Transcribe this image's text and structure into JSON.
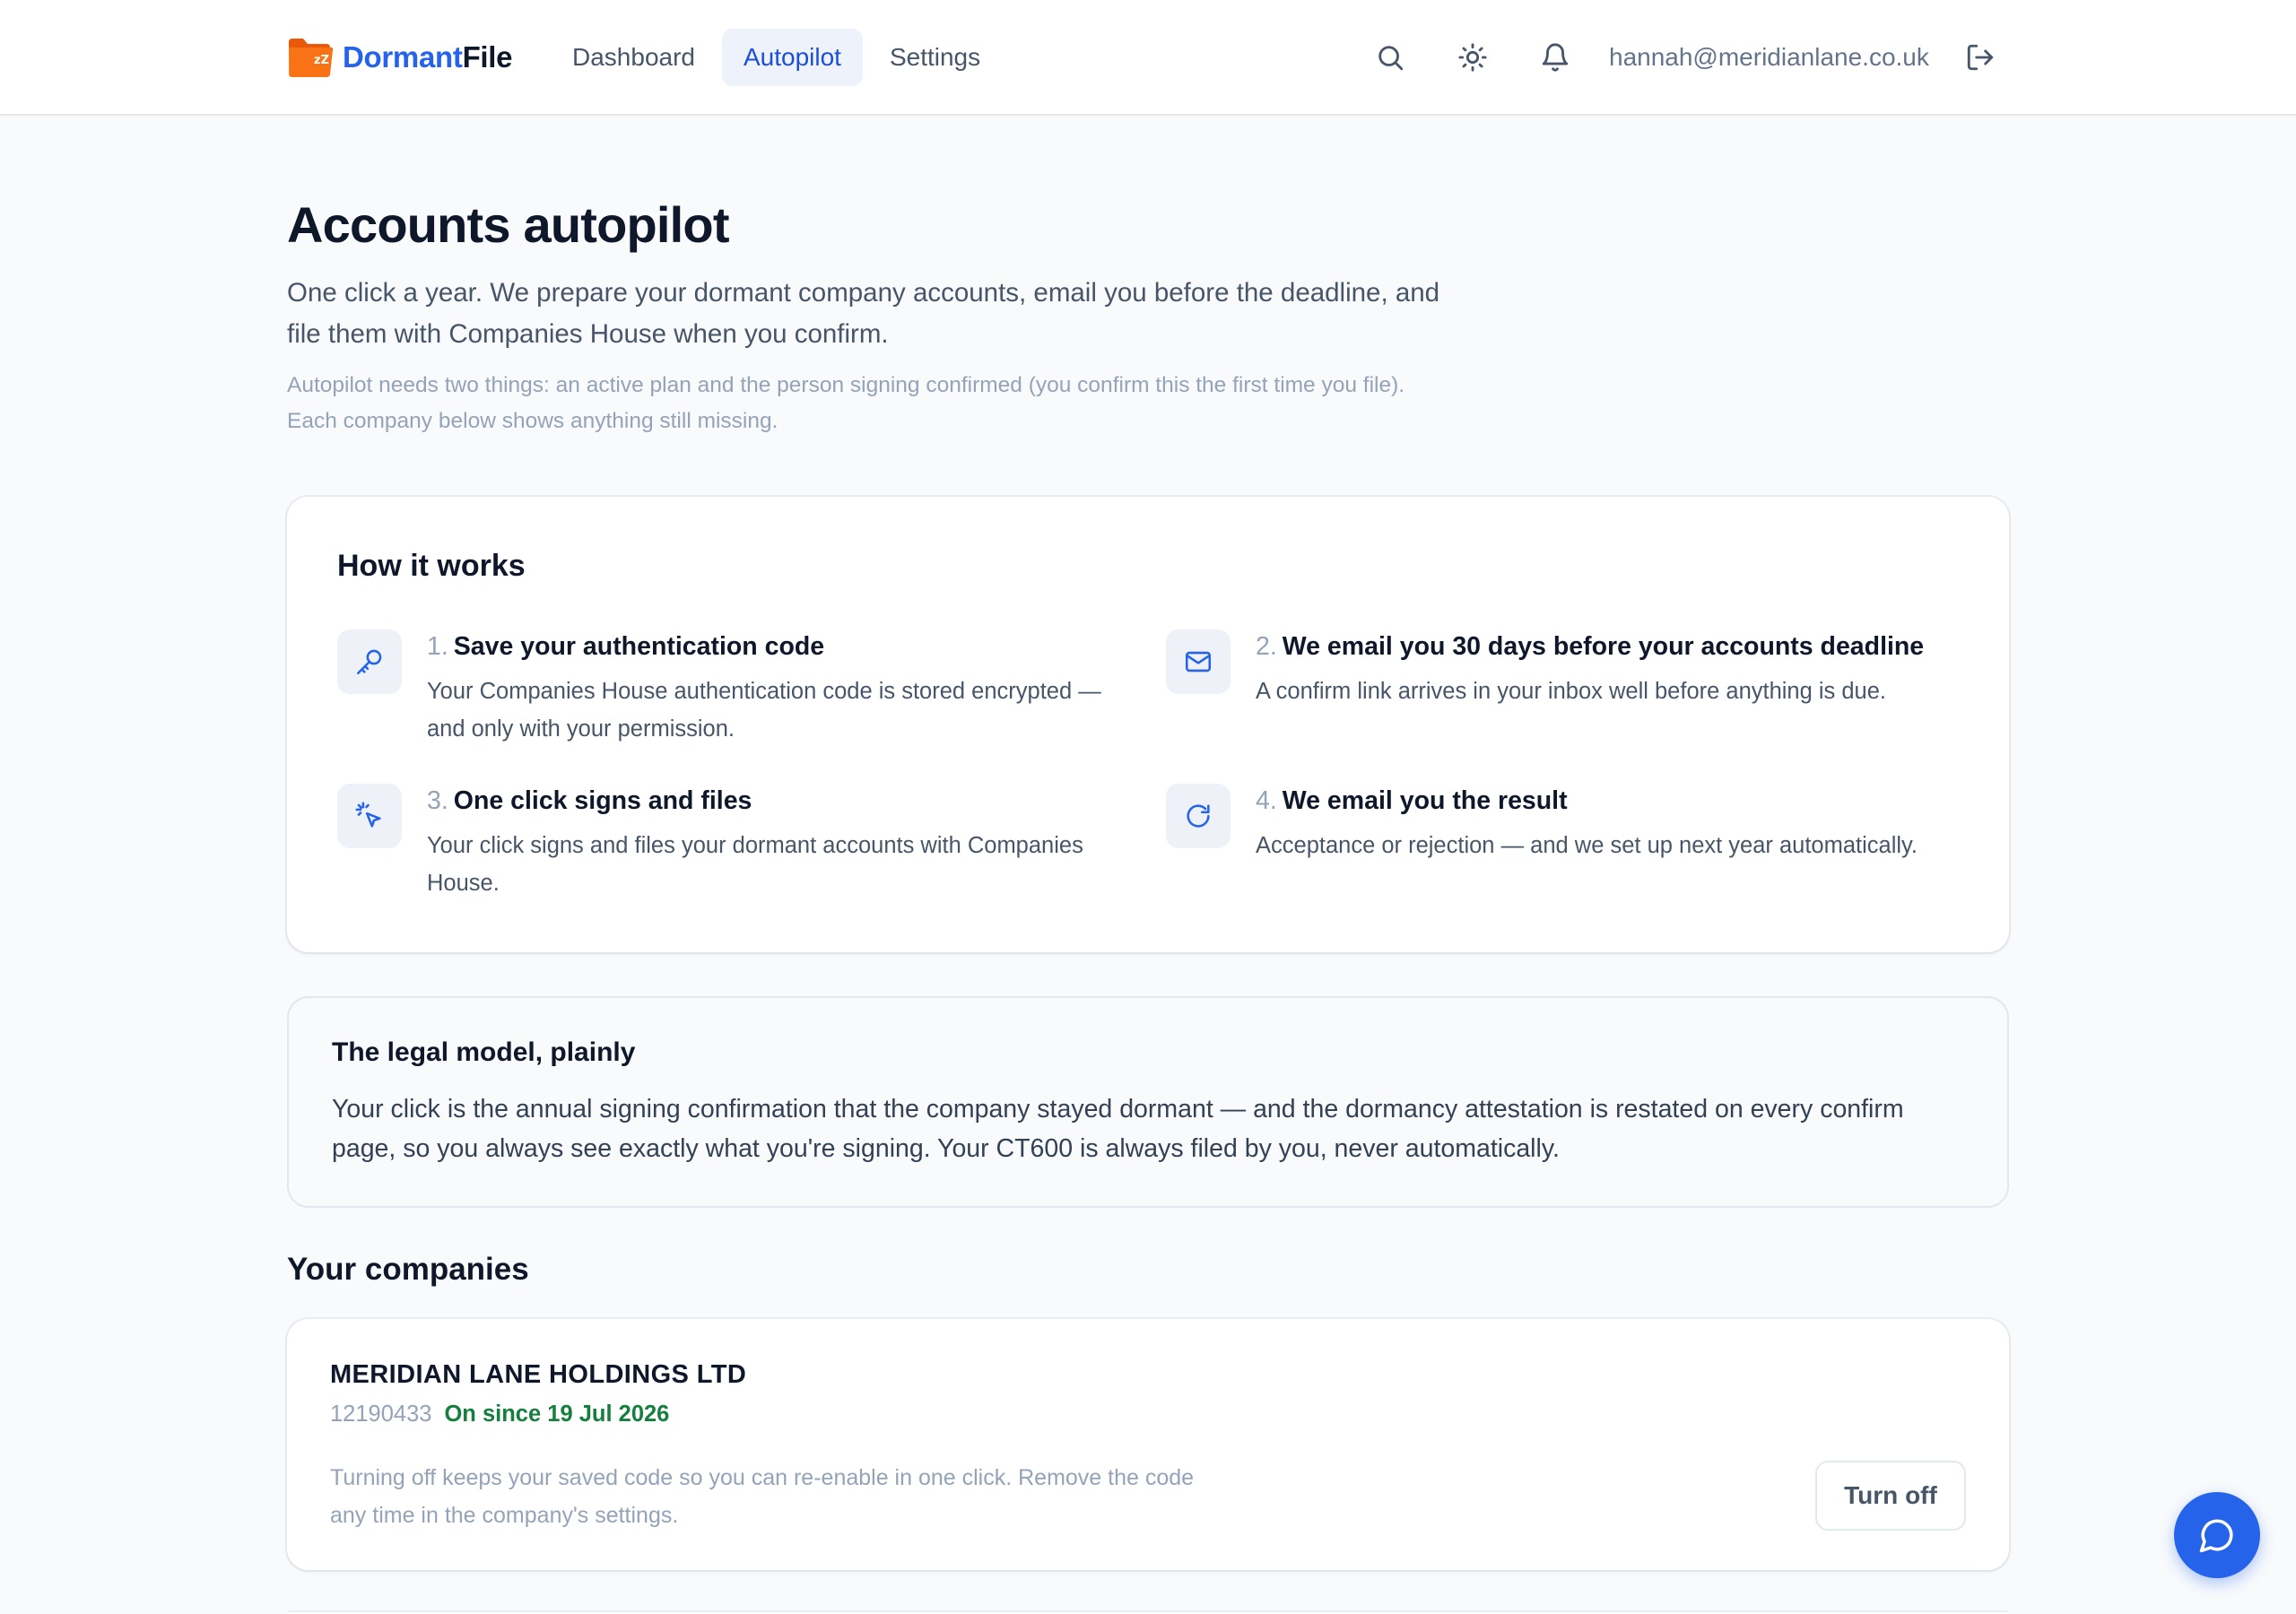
{
  "header": {
    "logo_part1": "Dormant",
    "logo_part2": "File",
    "nav": [
      {
        "label": "Dashboard",
        "active": false
      },
      {
        "label": "Autopilot",
        "active": true
      },
      {
        "label": "Settings",
        "active": false
      }
    ],
    "icons": [
      "search-icon",
      "theme-sun-icon",
      "bell-icon",
      "logout-icon"
    ],
    "user_email": "hannah@meridianlane.co.uk"
  },
  "page": {
    "title": "Accounts autopilot",
    "lead": "One click a year. We prepare your dormant company accounts, email you before the deadline, and file them with Companies House when you confirm.",
    "note": "Autopilot needs two things: an active plan and the person signing confirmed (you confirm this the first time you file). Each company below shows anything still missing."
  },
  "how_it_works": {
    "title": "How it works",
    "steps": [
      {
        "num": "1.",
        "title": "Save your authentication code",
        "desc": "Your Companies House authentication code is stored encrypted — and only with your permission.",
        "icon": "key-icon"
      },
      {
        "num": "2.",
        "title": "We email you 30 days before your accounts deadline",
        "desc": "A confirm link arrives in your inbox well before anything is due.",
        "icon": "mail-icon"
      },
      {
        "num": "3.",
        "title": "One click signs and files",
        "desc": "Your click signs and files your dormant accounts with Companies House.",
        "icon": "click-icon"
      },
      {
        "num": "4.",
        "title": "We email you the result",
        "desc": "Acceptance or rejection — and we set up next year automatically.",
        "icon": "refresh-icon"
      }
    ]
  },
  "legal": {
    "title": "The legal model, plainly",
    "body": "Your click is the annual signing confirmation that the company stayed dormant — and the dormancy attestation is restated on every confirm page, so you always see exactly what you're signing. Your CT600 is always filed by you, never automatically."
  },
  "companies": {
    "title": "Your companies",
    "items": [
      {
        "name": "MERIDIAN LANE HOLDINGS LTD",
        "number": "12190433",
        "status": "On since 19 Jul 2026",
        "help": "Turning off keeps your saved code so you can re-enable in one click. Remove the code any time in the company's settings.",
        "action": "Turn off"
      }
    ]
  },
  "colors": {
    "brand": "#2563eb",
    "logo_orange": "#f97316",
    "status_green": "#15803d"
  }
}
